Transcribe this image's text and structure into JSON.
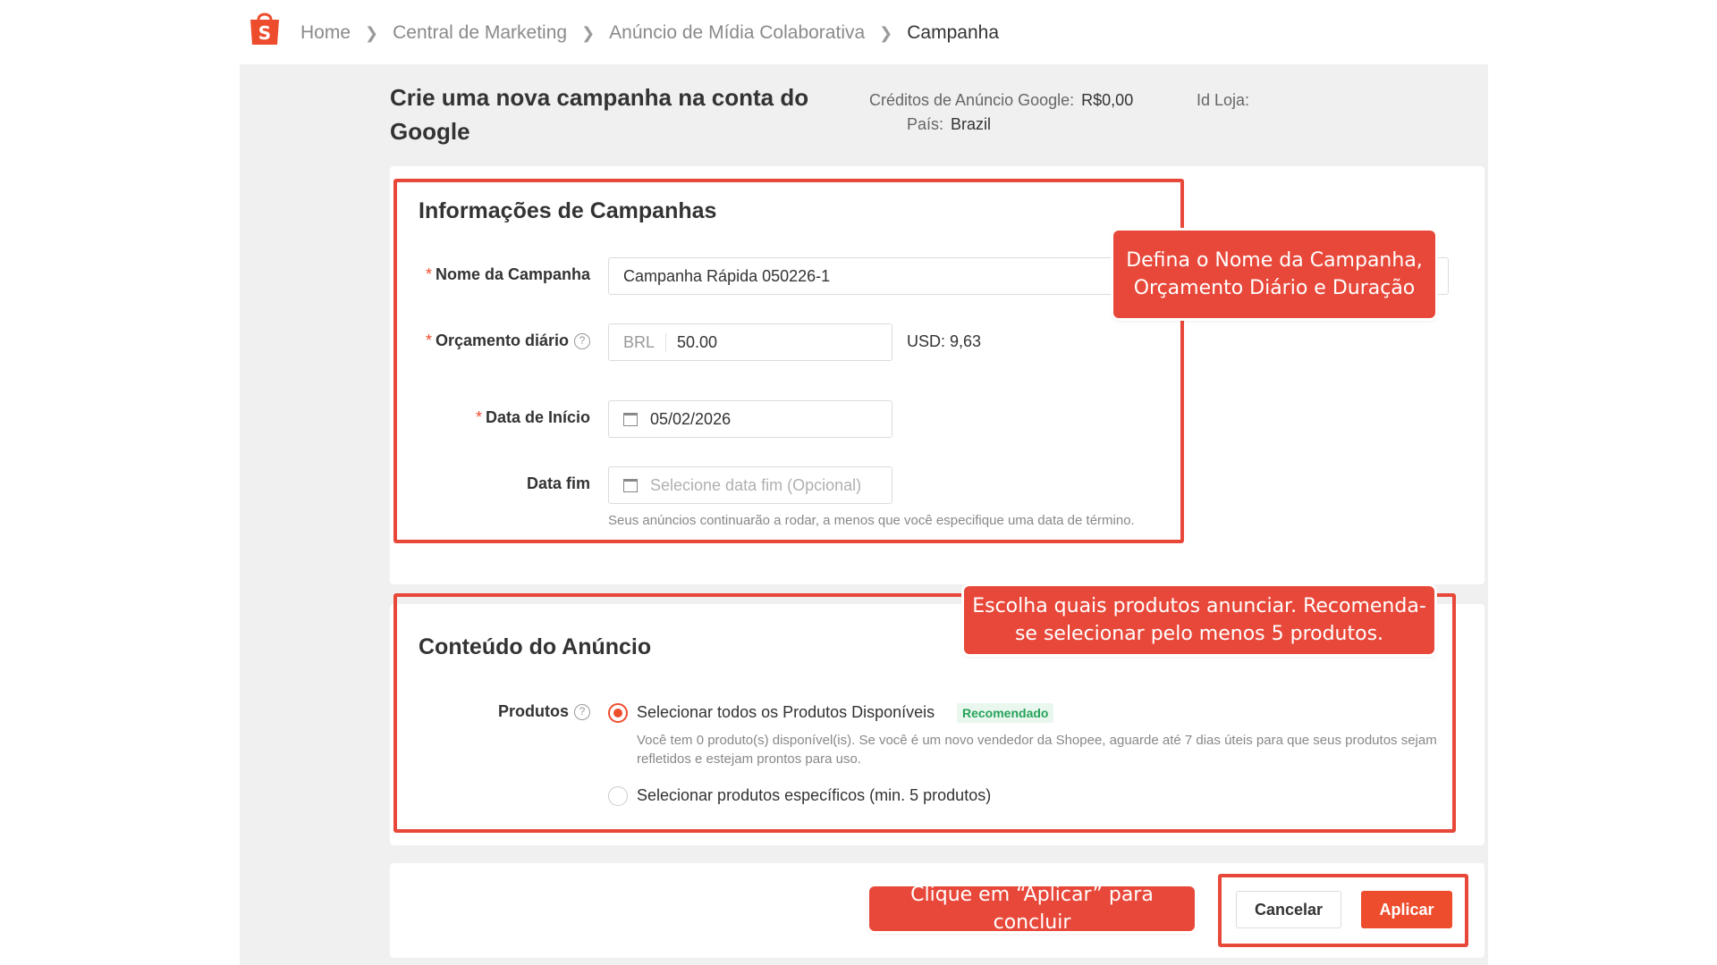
{
  "breadcrumb": {
    "home": "Home",
    "marketing": "Central de Marketing",
    "collab": "Anúncio de Mídia Colaborativa",
    "current": "Campanha"
  },
  "header": {
    "title": "Crie uma nova campanha na conta do Google",
    "credits_label": "Créditos de Anúncio Google:",
    "credits_value": "R$0,00",
    "store_id_label": "Id Loja:",
    "country_label": "País:",
    "country_value": "Brazil"
  },
  "campaign_info": {
    "title": "Informações de Campanhas",
    "name_label": "Nome da Campanha",
    "name_value": "Campanha Rápida 050226-1",
    "budget_label": "Orçamento diário",
    "budget_currency": "BRL",
    "budget_value": "50.00",
    "budget_usd": "USD: 9,63",
    "start_label": "Data de Início",
    "start_value": "05/02/2026",
    "end_label": "Data fim",
    "end_placeholder": "Selecione data fim (Opcional)",
    "end_hint": "Seus anúncios continuarão a rodar, a menos que você especifique uma data de término."
  },
  "ad_content": {
    "title": "Conteúdo do Anúncio",
    "products_label": "Produtos",
    "option_all": "Selecionar todos os Produtos Disponíveis",
    "recommended_badge": "Recomendado",
    "option_all_hint": "Você tem 0 produto(s) disponível(is). Se você é um novo vendedor da Shopee, aguarde até 7 dias úteis para que seus produtos sejam refletidos e estejam prontos para uso.",
    "option_specific": "Selecionar produtos específicos (min. 5 produtos)",
    "selected_option": "all"
  },
  "actions": {
    "cancel": "Cancelar",
    "apply": "Aplicar"
  },
  "tooltips": {
    "campaign": "Defina o Nome da Campanha, Orçamento Diário e Duração",
    "products": "Escolha quais produtos anunciar. Recomenda-se selecionar pelo menos 5 produtos.",
    "apply": "Clique em “Aplicar” para concluir"
  },
  "colors": {
    "accent": "#ee4d2d",
    "highlight": "#e8483a",
    "page_bg": "#f0f0f0"
  }
}
